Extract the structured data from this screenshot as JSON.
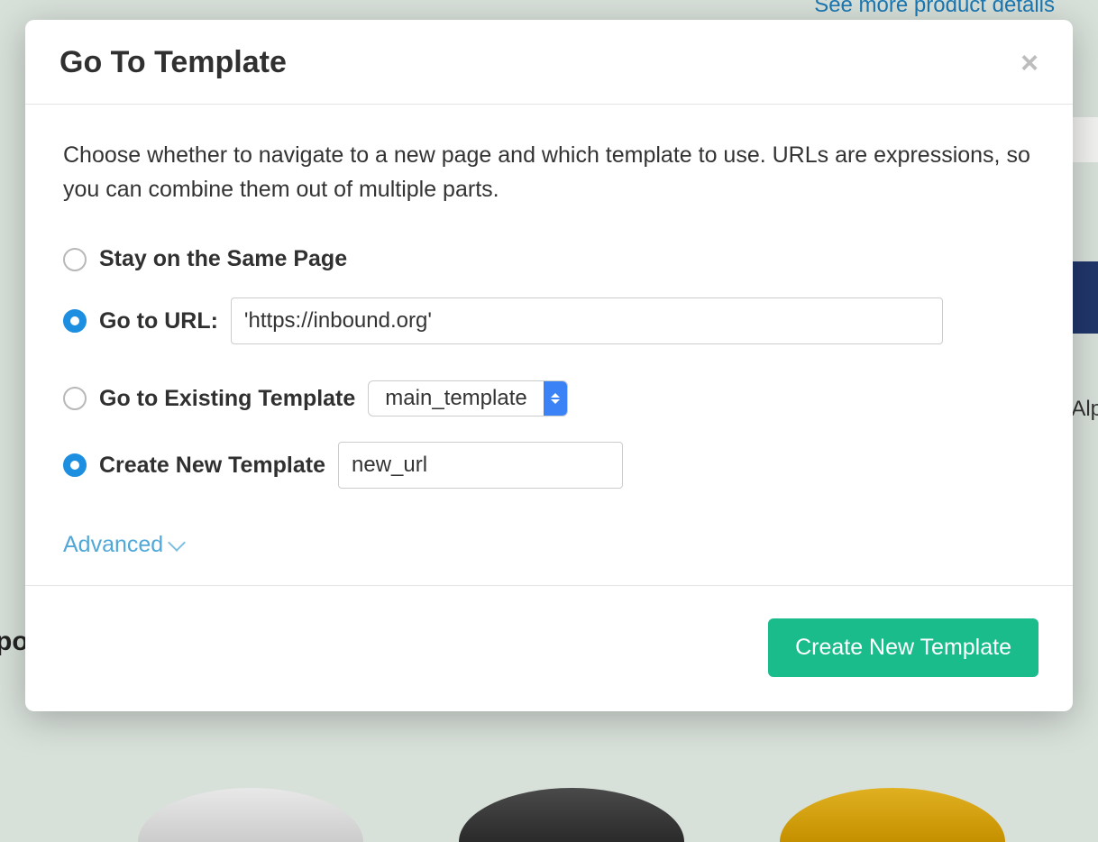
{
  "background": {
    "detailsLink": "See more product details",
    "rightText": "Alp",
    "leftText": "po"
  },
  "modal": {
    "title": "Go To Template",
    "description": "Choose whether to navigate to a new page and which template to use. URLs are expressions, so you can combine them out of multiple parts.",
    "options": {
      "stay": {
        "label": "Stay on the Same Page"
      },
      "url": {
        "label": "Go to URL:",
        "value": "'https://inbound.org'"
      },
      "existing": {
        "label": "Go to Existing Template",
        "selected": "main_template"
      },
      "create": {
        "label": "Create New Template",
        "value": "new_url"
      }
    },
    "advanced": "Advanced",
    "submit": "Create New Template"
  }
}
